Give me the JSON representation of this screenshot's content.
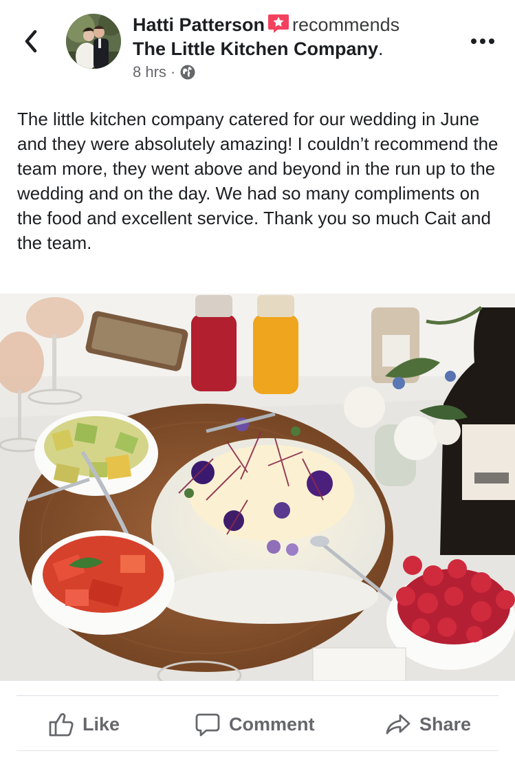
{
  "header": {
    "author": "Hatti Patterson",
    "verb": "recommends",
    "page": "The Little Kitchen Company",
    "page_suffix": ".",
    "time": "8 hrs",
    "separator": "·",
    "audience_icon": "globe-icon",
    "back_icon": "chevron-left-icon",
    "more_icon": "more-dots-icon",
    "recommend_icon": "recommend-star-icon",
    "recommend_color": "#f3425f"
  },
  "post": {
    "text": "The little kitchen company catered for our wedding in June and they were absolutely amazing! I couldn’t recommend the team more, they went above and beyond in the run up to the wedding and on the day. We had so many compliments on the food and excellent service. Thank you so much Cait and the team."
  },
  "actions": {
    "like": "Like",
    "comment": "Comment",
    "share": "Share",
    "like_icon": "thumbs-up-icon",
    "comment_icon": "speech-bubble-icon",
    "share_icon": "share-arrow-icon"
  },
  "colors": {
    "text": "#1c1e21",
    "secondary": "#65676b"
  }
}
